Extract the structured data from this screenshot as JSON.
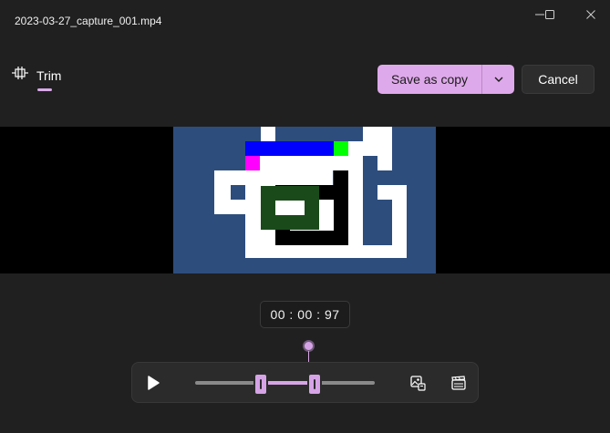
{
  "window": {
    "title": "2023-03-27_capture_001.mp4",
    "controls": [
      "minimize-icon",
      "maximize-icon",
      "close-icon"
    ]
  },
  "toolbar": {
    "trim_label": "Trim",
    "trim_icon": "trim-icon",
    "save_label": "Save as copy",
    "save_dropdown_icon": "chevron-down-icon",
    "cancel_label": "Cancel"
  },
  "playback": {
    "timestamp": "00 : 00 : 97",
    "play_icon": "play-icon",
    "snapshot_icon": "save-frame-icon",
    "clip_icon": "clapperboard-icon"
  },
  "colors": {
    "accent": "#dea9ea",
    "background": "#202020",
    "video_bg": "#2d4d7c"
  }
}
